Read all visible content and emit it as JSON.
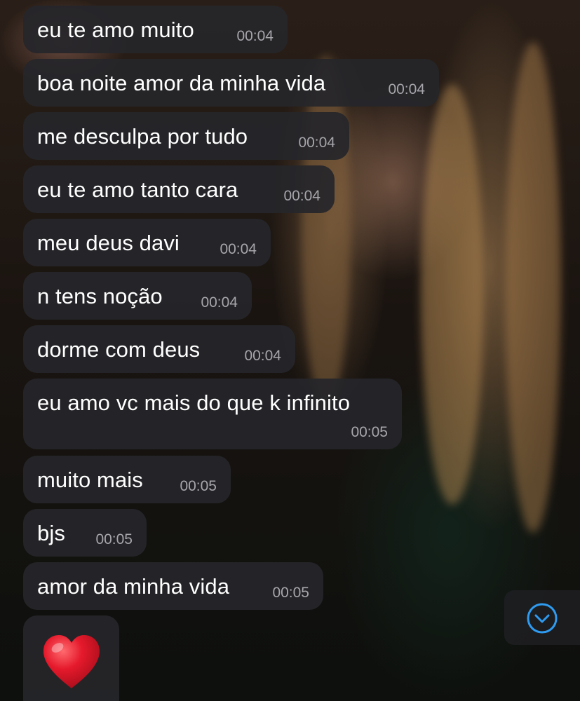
{
  "chat": {
    "messages": [
      {
        "text": "eu te amo muito",
        "time": "00:04"
      },
      {
        "text": "boa noite amor da minha vida",
        "time": "00:04"
      },
      {
        "text": "me desculpa por tudo",
        "time": "00:04"
      },
      {
        "text": "eu te amo tanto cara",
        "time": "00:04"
      },
      {
        "text": "meu deus davi",
        "time": "00:04"
      },
      {
        "text": "n tens noção",
        "time": "00:04"
      },
      {
        "text": "dorme com deus",
        "time": "00:04"
      },
      {
        "text": "eu amo vc mais do que k infinito",
        "time": "00:05"
      },
      {
        "text": "muito mais",
        "time": "00:05"
      },
      {
        "text": "bjs",
        "time": "00:05"
      },
      {
        "text": "amor da minha vida",
        "time": "00:05"
      }
    ],
    "last_message": {
      "emoji": "red-heart-icon"
    }
  },
  "controls": {
    "scroll_down_icon": "chevron-down-circle-icon"
  },
  "colors": {
    "bubble_bg": "#26262a",
    "message_text": "#ffffff",
    "timestamp_text": "#a6a6ab",
    "accent": "#2f9bf0",
    "heart": "#e0182b"
  }
}
